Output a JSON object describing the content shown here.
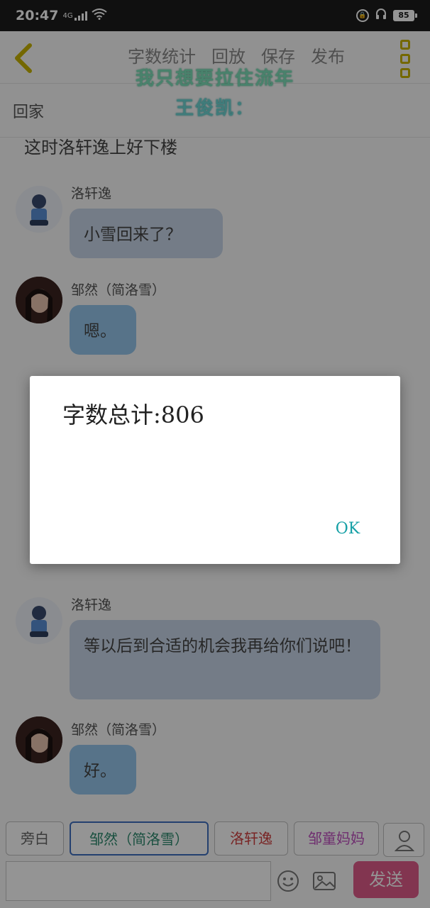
{
  "status_bar": {
    "time": "20:47",
    "network": "4G",
    "battery": "85"
  },
  "toolbar": {
    "menu": [
      "字数统计",
      "回放",
      "保存",
      "发布"
    ]
  },
  "watermark": {
    "line1": "我只想要拉住流年",
    "line2": "王俊凯："
  },
  "chapter": {
    "title": "回家"
  },
  "conversation": {
    "narration": "这时洛轩逸上好下楼",
    "messages": [
      {
        "speaker": "洛轩逸",
        "text": "小雪回来了？"
      },
      {
        "speaker": "邹然（简洛雪）",
        "text": "嗯。"
      },
      {
        "speaker": "洛轩逸",
        "text": "等以后到合适的机会我再给你们说吧！"
      },
      {
        "speaker": "邹然（简洛雪）",
        "text": "好。"
      }
    ]
  },
  "dialog": {
    "message": "字数总计:806",
    "ok_label": "OK"
  },
  "roles": {
    "tabs": [
      "旁白",
      "邹然（简洛雪）",
      "洛轩逸",
      "邹童妈妈"
    ]
  },
  "composer": {
    "send_label": "发送"
  },
  "colors": {
    "accent_send": "#e05c8a",
    "ok_text": "#16a0a6",
    "bubble_girl": "#97c7ec",
    "bubble_boy": "#c9d6e8",
    "kebab": "#c8b400"
  }
}
